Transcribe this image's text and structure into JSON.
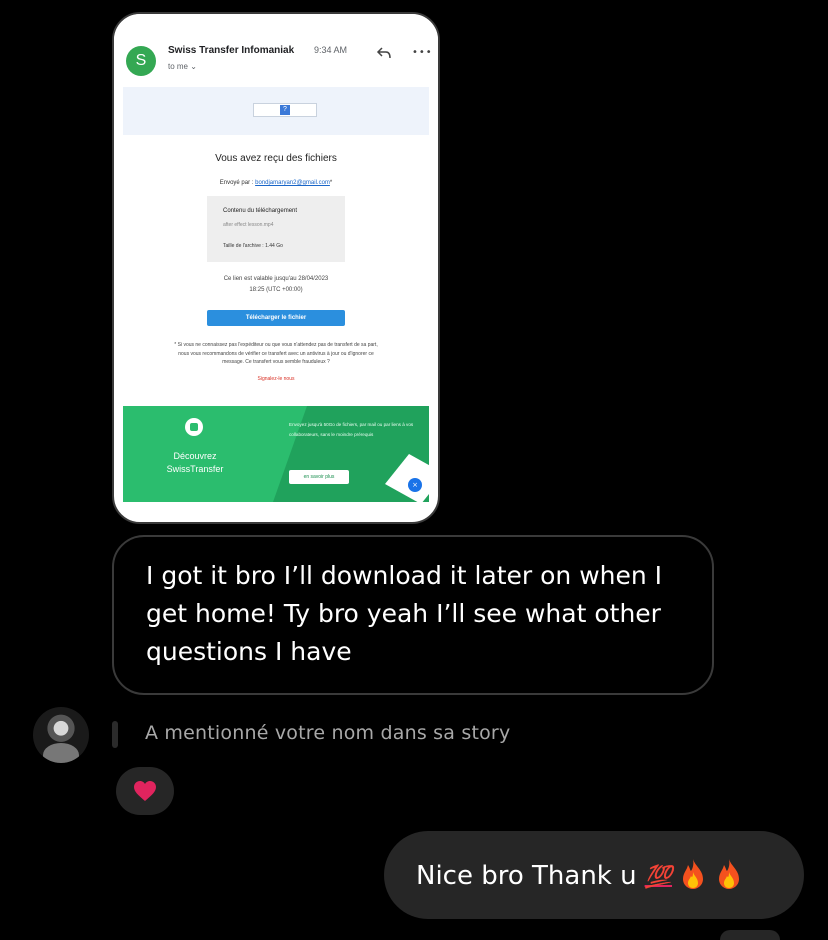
{
  "email_screenshot": {
    "sender_initial": "S",
    "sender": "Swiss Transfer Infomaniak",
    "time": "9:34 AM",
    "recipient": "to me",
    "banner_icon": "?",
    "title": "Vous avez reçu des fichiers",
    "sent_by_label": "Envoyé par :",
    "sent_by_email": "bondjamaryan2@gmail.com",
    "content_heading": "Contenu du téléchargement",
    "file_name": "after effect lesson.mp4",
    "archive_size": "Taille de l'archive : 1.44 Go",
    "validity_line1": "Ce lien est valable jusqu'au 28/04/2023",
    "validity_line2": "18:25 (UTC +00:00)",
    "download_button": "Télécharger le fichier",
    "warning": "* Si vous ne connaissez pas l'expéditeur ou que vous n'attendez pas de transfert de sa part, nous vous recommandons de vérifier ce transfert avec un antivirus à jour ou d'ignorer ce message. Ce transfert vous semble frauduleux ?",
    "report_link": "Signalez-le nous",
    "promo_title": "Découvrez SwissTransfer",
    "promo_text": "Envoyez jusqu'à 50Go de fichiers, par mail ou par liens à vos collaborateurs, sans le moindre prérequis",
    "promo_button": "en savoir plus",
    "promo_close": "×"
  },
  "messages": {
    "incoming_text": "I got it bro I’ll download it later on when I get home! Ty bro yeah I’ll see what other questions I have",
    "story_mention": "A mentionné votre nom dans sa story",
    "reaction": "heart",
    "outgoing_text": "Nice bro Thank u",
    "outgoing_emoji_100": "💯",
    "outgoing_emojis": [
      "fire",
      "fire"
    ]
  },
  "colors": {
    "background": "#000000",
    "bubble_outgoing": "#262626",
    "bubble_incoming_border": "#3a3a3a",
    "gmail_avatar": "#34a853",
    "download_button": "#2b8fde",
    "promo_green": "#2bbd6e",
    "heart_red": "#e0245e"
  }
}
